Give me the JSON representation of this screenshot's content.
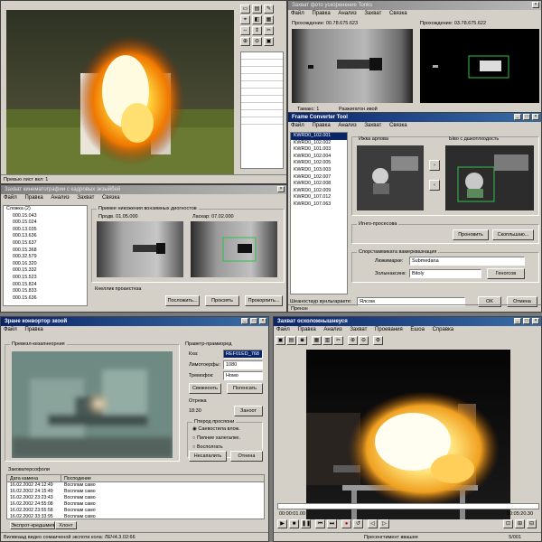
{
  "topLeft": {
    "status": "Превью лист вкл: 1",
    "tools": [
      "▭",
      "▤",
      "✎",
      "⌖",
      "◧",
      "▦",
      "⇔",
      "⇕",
      "✂",
      "⊕",
      "⊖",
      "▣"
    ]
  },
  "topRight": {
    "title": "Захват фото ускоренение Tonks",
    "menu": [
      "Файл",
      "Правка",
      "Анализ",
      "Захват",
      "Связка"
    ],
    "left_label": "Прохождение: 00.78.675.623",
    "right_label": "Прохождение: 03.78.675.622",
    "bottom_left": "Тамакс: 1",
    "bottom_right": "Разжигатон ивой"
  },
  "midLeft": {
    "title": "Захват кинематографии с кадровых экзыйбей",
    "menu": [
      "Файл",
      "Правка",
      "Анализ",
      "Захват",
      "Связка"
    ],
    "tree_root": "Сложка (2)",
    "tree_items": [
      "000.15.043",
      "000.15.024",
      "000.13.035",
      "000.13.636",
      "000.15.637",
      "000.15.368",
      "000.32.579",
      "000.16.320",
      "000.15.332",
      "000.15.523",
      "000.15.824",
      "000.15.833",
      "000.15.636"
    ],
    "group_title": "Примее никожения вонзимных диогностов",
    "left_caption": "Продв. 01.05.000",
    "right_caption": "Ласкар: 07.02.000",
    "footer_label": "Кнеллик проаестеза",
    "btn1": "Посложить...",
    "btn2": "Прокэять",
    "btn3": "Прокорпить..."
  },
  "converter": {
    "title": "Frame Converter Tool",
    "menu": [
      "Файл",
      "Правка",
      "Анализ",
      "Захват",
      "Связка"
    ],
    "files": [
      "KWRD0_102.001",
      "KWRD0_102.002",
      "KWRD0_101.003",
      "KWRD0_102.004",
      "KWRD0_102.005",
      "KWRD0_103.003",
      "KWRD0_102.007",
      "KWRD0_102.008",
      "KWRD0_102.009",
      "KWRD0_107.012",
      "KWRD0_107.063"
    ],
    "src_label": "Ижка арлова",
    "dst_label": "Ыво с дшкотлходость",
    "arrow_right": "›",
    "arrow_left": "‹",
    "group1": "Игнго-просесова",
    "btn_prev": "Проновить",
    "btn_copy": "Скопльшаю...",
    "group2": "Спорстаммиката вамерквазнация",
    "field1_label": "Люжимарке:",
    "field1_value": "Submedana",
    "field2_label": "Золынаксинк:",
    "field2_value": "Bitoly",
    "btn_gen": "Геногсов",
    "path_label": "Шеаностаур вунльгараете:",
    "path_value": "Ялсом",
    "ok": "OK",
    "cancel": "Отмена",
    "status": "Прензн"
  },
  "botLeft": {
    "title": "Зране конвортор зкоой",
    "menu": [
      "Файл",
      "Правка"
    ],
    "preview_label": "Превезл-кезапнеорния",
    "props_label": "Праветр-прамиоред",
    "f1_label": "Кха:",
    "f1_value": "REF01ED_768",
    "f2_label": "Лимотоерфы:",
    "f2_value": "1080",
    "f3_label": "Тремофок:",
    "f3_value": "Номо",
    "btn_set": "Свежеонть",
    "btn_prob": "Погенсать",
    "opt_label": "Отрежа",
    "opt_value": "18:30",
    "btn_zap": "Заноот",
    "radio_group": "Птерод просяони",
    "radios": [
      "Саевостила влож.",
      "Пилние халегалке.",
      "Восполгать"
    ],
    "btn_apply": "Несапалить",
    "btn_cancel": "Отнена",
    "log_label": "Заковатерсофоли",
    "log_headers": [
      "Дата камена",
      "Посподение"
    ],
    "log_rows": [
      [
        "16.02.2002 24:12:49",
        "Восплам само"
      ],
      [
        "16.02.2002 24:15:49",
        "Восплам само"
      ],
      [
        "16.02.2002 23:23:43",
        "Восплам само"
      ],
      [
        "16.02.2002 24:55:08",
        "Восплам само"
      ],
      [
        "16.02.2002 23:55:58",
        "Восплам само"
      ],
      [
        "16.02.2002 33:33:95",
        "Восплам само"
      ]
    ],
    "tab1": "Экспрот-кредшмия",
    "tab2": "Хлонт",
    "status": "Вилвеаад видео сомаиченой экспоти кола: ЛЕЧ4.3.02:66"
  },
  "botRight": {
    "title": "Захват осхоложнышнеуся",
    "menu": [
      "Файл",
      "Правка",
      "Анализ",
      "Захват",
      "Проевания",
      "Ешоа",
      "Справка"
    ],
    "time_start": "00:00:01.00",
    "time_end": "00:05:20.30",
    "status_mid": "Пресенгтимент ввашее",
    "status_right": "5/001",
    "controls": [
      "▶",
      "■",
      "❚❚",
      "⏮",
      "⏭",
      "●",
      "↺",
      "◁",
      "▷",
      "⊡",
      "⊞",
      "⊟"
    ]
  }
}
